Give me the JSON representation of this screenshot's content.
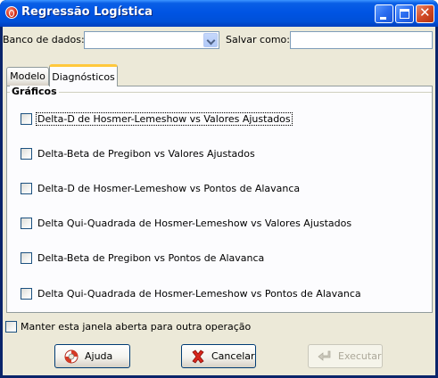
{
  "window": {
    "title": "Regressão Logística",
    "controls": [
      "minimize",
      "maximize",
      "close"
    ]
  },
  "header": {
    "database_label": "Banco de dados:",
    "database_value": "",
    "save_as_label": "Salvar como:",
    "save_as_value": ""
  },
  "tabs": [
    {
      "label": "Modelo",
      "selected": false
    },
    {
      "label": "Diagnósticos",
      "selected": true
    }
  ],
  "graphics_group": {
    "title": "Gráficos",
    "options": [
      {
        "label": "Delta-D de Hosmer-Lemeshow vs Valores Ajustados",
        "checked": false,
        "focused": true
      },
      {
        "label": "Delta-Beta de Pregibon vs Valores Ajustados",
        "checked": false
      },
      {
        "label": "Delta-D de Hosmer-Lemeshow vs Pontos de Alavanca",
        "checked": false
      },
      {
        "label": "Delta Qui-Quadrada de Hosmer-Lemeshow vs Valores Ajustados",
        "checked": false
      },
      {
        "label": "Delta-Beta de Pregibon vs Pontos de Alavanca",
        "checked": false
      },
      {
        "label": "Delta Qui-Quadrada de Hosmer-Lemeshow vs Pontos de Alavanca",
        "checked": false
      }
    ]
  },
  "keep_open": {
    "label": "Manter esta janela aberta para outra operação",
    "checked": false
  },
  "buttons": {
    "help": "Ajuda",
    "cancel": "Cancelar",
    "execute": "Executar"
  },
  "colors": {
    "titlebar": "#0054e3",
    "dialog_bg": "#ece9d8",
    "panel_bg": "#fcfcfe",
    "tab_highlight": "#ffc83c"
  }
}
